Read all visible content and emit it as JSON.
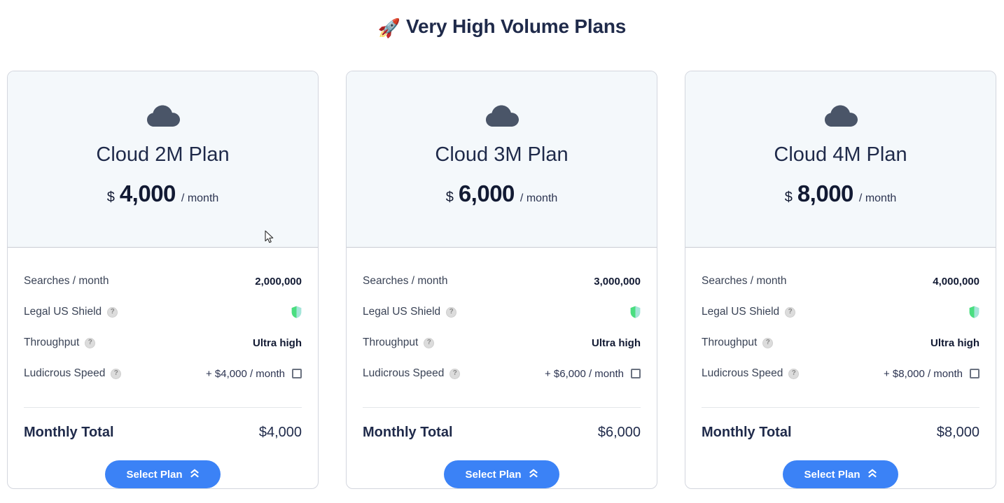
{
  "header": {
    "icon": "rocket-icon",
    "icon_glyph": "🚀",
    "title": "Very High Volume Plans"
  },
  "colors": {
    "accent_blue": "#3b82f6",
    "title_navy": "#1f2a4a",
    "card_header_bg": "#f4f8fb",
    "card_border": "#d3d6de",
    "cloud_icon": "#4a5568",
    "shield_green": "#4ade80",
    "shield_teal": "#a5e5d9",
    "help_icon_grey": "#dcdcdc"
  },
  "labels": {
    "searches": "Searches / month",
    "legal_shield": "Legal US Shield",
    "throughput": "Throughput",
    "ludicrous_speed": "Ludicrous Speed",
    "monthly_total": "Monthly Total",
    "select_plan": "Select Plan",
    "currency": "$",
    "period": "/ month",
    "help": "?"
  },
  "plans": [
    {
      "icon": "cloud-icon",
      "name": "Cloud 2M Plan",
      "currency": "$",
      "price": "4,000",
      "period": "/ month",
      "searches": "2,000,000",
      "legal_shield": "included",
      "throughput": "Ultra high",
      "ludicrous_speed_price": "+ $4,000 / month",
      "ludicrous_speed_checked": false,
      "total": "$4,000",
      "cta": "Select Plan"
    },
    {
      "icon": "cloud-icon",
      "name": "Cloud 3M Plan",
      "currency": "$",
      "price": "6,000",
      "period": "/ month",
      "searches": "3,000,000",
      "legal_shield": "included",
      "throughput": "Ultra high",
      "ludicrous_speed_price": "+ $6,000 / month",
      "ludicrous_speed_checked": false,
      "total": "$6,000",
      "cta": "Select Plan"
    },
    {
      "icon": "cloud-icon",
      "name": "Cloud 4M Plan",
      "currency": "$",
      "price": "8,000",
      "period": "/ month",
      "searches": "4,000,000",
      "legal_shield": "included",
      "throughput": "Ultra high",
      "ludicrous_speed_price": "+ $8,000 / month",
      "ludicrous_speed_checked": false,
      "total": "$8,000",
      "cta": "Select Plan"
    }
  ]
}
